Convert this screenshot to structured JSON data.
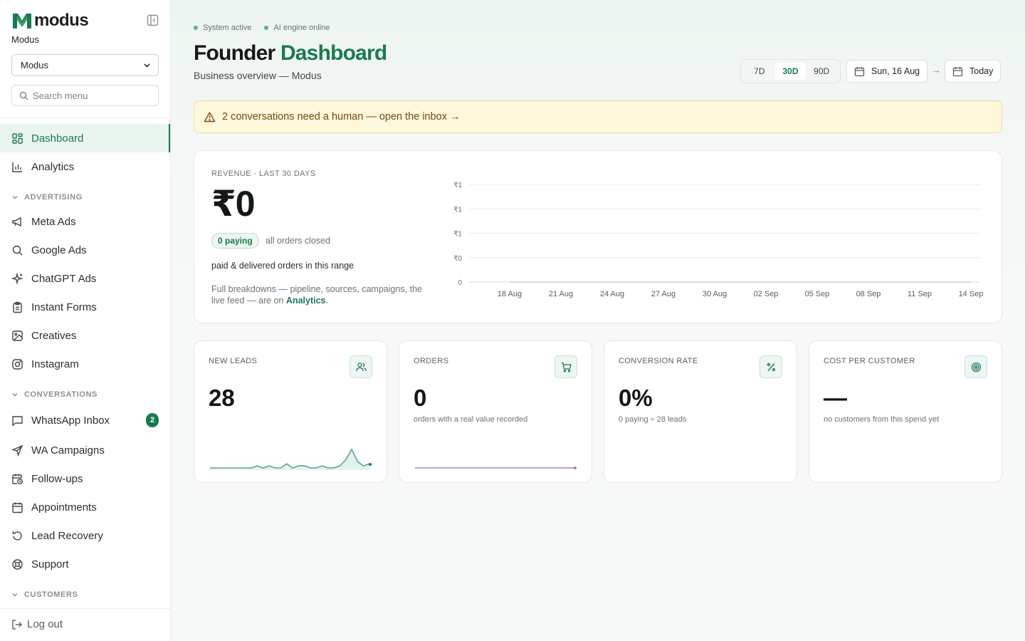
{
  "brand": {
    "wordmark": "modus",
    "workspace_label": "Modus",
    "workspace_selected": "Modus",
    "search_placeholder": "Search menu"
  },
  "colors": {
    "accent": "#1a7a4f",
    "alert_bg": "#fdf7dc",
    "alert_text": "#7a4a08",
    "orders_line": "#a07fd8"
  },
  "sidebar": {
    "items": [
      {
        "label": "Dashboard",
        "icon": "dashboard-icon",
        "active": true
      },
      {
        "label": "Analytics",
        "icon": "bar-chart-icon"
      },
      {
        "section": "ADVERTISING"
      },
      {
        "label": "Meta Ads",
        "icon": "megaphone-icon"
      },
      {
        "label": "Google Ads",
        "icon": "search-icon"
      },
      {
        "label": "ChatGPT Ads",
        "icon": "sparkles-icon"
      },
      {
        "label": "Instant Forms",
        "icon": "clipboard-icon"
      },
      {
        "label": "Creatives",
        "icon": "image-icon"
      },
      {
        "label": "Instagram",
        "icon": "instagram-icon"
      },
      {
        "section": "CONVERSATIONS"
      },
      {
        "label": "WhatsApp Inbox",
        "icon": "message-icon",
        "badge": "2"
      },
      {
        "label": "WA Campaigns",
        "icon": "send-icon"
      },
      {
        "label": "Follow-ups",
        "icon": "calendar-clock-icon"
      },
      {
        "label": "Appointments",
        "icon": "calendar-icon"
      },
      {
        "label": "Lead Recovery",
        "icon": "rotate-ccw-icon"
      },
      {
        "label": "Support",
        "icon": "life-buoy-icon"
      },
      {
        "section": "CUSTOMERS"
      }
    ],
    "logout_label": "Log out"
  },
  "header": {
    "status": [
      "System active",
      "AI engine online"
    ],
    "title_main": "Founder",
    "title_accent": "Dashboard",
    "subtitle": "Business overview — Modus",
    "ranges": [
      "7D",
      "30D",
      "90D"
    ],
    "active_range": "30D",
    "date_from": "Sun, 16 Aug",
    "date_arrow": "→",
    "date_to": "Today"
  },
  "alert": {
    "text": "2 conversations need a human — open the inbox →"
  },
  "revenue": {
    "label": "REVENUE · LAST 30 DAYS",
    "value": "₹0",
    "paying_pill": "0 paying",
    "paying_note": "all orders closed",
    "description": "paid & delivered orders in this range",
    "footnote": "Full breakdowns — pipeline, sources, campaigns, the live feed — are on ",
    "footnote_link": "Analytics",
    "footnote_end": "."
  },
  "chart_data": {
    "type": "line",
    "title": "",
    "y_tick_labels": [
      "₹1",
      "₹1",
      "₹1",
      "₹0",
      "0"
    ],
    "x_tick_labels": [
      "18 Aug",
      "21 Aug",
      "24 Aug",
      "27 Aug",
      "30 Aug",
      "02 Sep",
      "05 Sep",
      "08 Sep",
      "11 Sep",
      "14 Sep"
    ],
    "series": [
      {
        "values": [
          0,
          0,
          0,
          0,
          0,
          0,
          0,
          0,
          0,
          0
        ]
      }
    ],
    "grid": true
  },
  "kpis": [
    {
      "label": "NEW LEADS",
      "value": "28",
      "sub": "",
      "icon": "users-icon",
      "spark": [
        0,
        0,
        0,
        0,
        0,
        0,
        0,
        0,
        1,
        0,
        1,
        0,
        0,
        2,
        0,
        1,
        1,
        0,
        0,
        1,
        0,
        0,
        1,
        4,
        9,
        3,
        1,
        2
      ],
      "spark_color": "#5aa882"
    },
    {
      "label": "ORDERS",
      "value": "0",
      "sub": "orders with a real value recorded",
      "icon": "cart-icon",
      "spark": [
        0,
        0,
        0,
        0,
        0,
        0,
        0,
        0,
        0,
        0
      ],
      "spark_color": "#a07fd8"
    },
    {
      "label": "CONVERSION RATE",
      "value": "0%",
      "sub": "0 paying ÷ 28 leads",
      "icon": "percent-icon"
    },
    {
      "label": "COST PER CUSTOMER",
      "value": "—",
      "sub": "no customers from this spend yet",
      "icon": "target-icon"
    }
  ]
}
